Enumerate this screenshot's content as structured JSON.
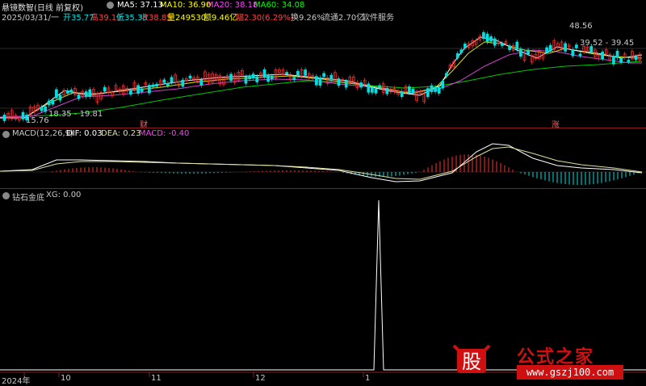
{
  "header": {
    "title": "悬镜数智(日线 前复权)",
    "ma5": "MA5: 37.13",
    "ma10": "MA10: 36.90",
    "ma20": "MA20: 38.18",
    "ma60": "MA60: 34.08",
    "date": "2025/03/31/一",
    "open": "开35.77",
    "high": "高39.19",
    "low": "低35.38",
    "close": "收38.85",
    "volume": "量249530",
    "amount": "额9.46亿",
    "change": "幅2.30(6.29%)",
    "turnover": "换9.26%",
    "float": "流通2.70亿",
    "sector": "软件服务"
  },
  "price_annotations": {
    "peak": "48.56",
    "range_right": "39.52 - 39.45",
    "range_left": "18.35 - 19.81",
    "low": "15.76",
    "marker_cai": "财",
    "marker_zhang": "涨"
  },
  "macd": {
    "title": "MACD(12,26,9)",
    "dif": "DIF: 0.03",
    "dea": "DEA: 0.23",
    "macd": "MACD: -0.40"
  },
  "xg": {
    "title": "钻石金底",
    "value": "XG: 0.00"
  },
  "axis": {
    "ticks": [
      "2024年",
      "10",
      "11",
      "12",
      "1"
    ]
  },
  "watermark": {
    "icon_char": "股",
    "text": "公式之家",
    "url": "www.gszj100.com"
  },
  "colors": {
    "up": "#ff3030",
    "down": "#00e0e0",
    "ma5": "#ffffff",
    "ma10": "#ffff00",
    "ma20": "#ff00ff",
    "ma60": "#00ff00",
    "separator": "#8b1a1a"
  }
}
